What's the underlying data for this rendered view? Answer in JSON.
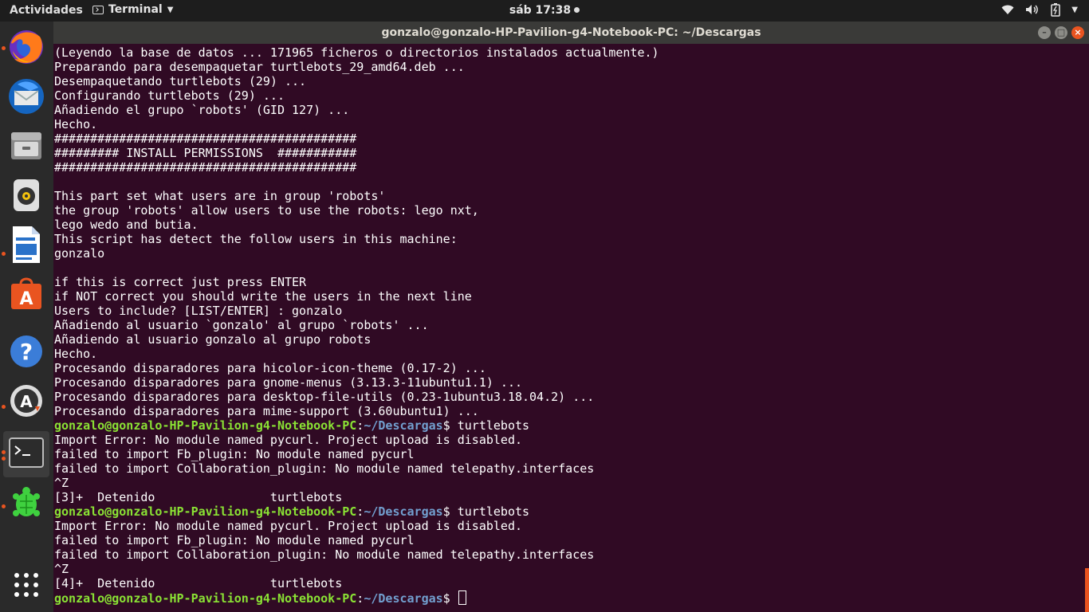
{
  "topbar": {
    "activities": "Actividades",
    "app_name": "Terminal",
    "clock": "sáb 17:38",
    "tray_icons": [
      "wifi-icon",
      "volume-icon",
      "battery-icon",
      "power-menu-icon"
    ]
  },
  "dock": {
    "items": [
      {
        "name": "firefox",
        "running": true
      },
      {
        "name": "thunderbird",
        "running": false
      },
      {
        "name": "files",
        "running": false
      },
      {
        "name": "rhythmbox",
        "running": false
      },
      {
        "name": "libreoffice-writer",
        "running": true
      },
      {
        "name": "ubuntu-software",
        "running": false
      },
      {
        "name": "help",
        "running": false
      },
      {
        "name": "software-updater",
        "running": true
      },
      {
        "name": "terminal",
        "running": true
      },
      {
        "name": "turtlebots",
        "running": true
      }
    ],
    "show_apps": "show-applications-icon"
  },
  "window": {
    "title": "gonzalo@gonzalo-HP-Pavilion-g4-Notebook-PC: ~/Descargas",
    "controls": [
      "minimize",
      "maximize",
      "close"
    ]
  },
  "prompt": {
    "user": "gonzalo@gonzalo-HP-Pavilion-g4-Notebook-PC",
    "sep": ":",
    "path": "~/Descargas",
    "symbol": "$ "
  },
  "terminal_lines": [
    "(Leyendo la base de datos ... 171965 ficheros o directorios instalados actualmente.)",
    "Preparando para desempaquetar turtlebots_29_amd64.deb ...",
    "Desempaquetando turtlebots (29) ...",
    "Configurando turtlebots (29) ...",
    "Añadiendo el grupo `robots' (GID 127) ...",
    "Hecho.",
    "##########################################",
    "######### INSTALL PERMISSIONS  ###########",
    "##########################################",
    "",
    "This part set what users are in group 'robots'",
    "the group 'robots' allow users to use the robots: lego nxt,",
    "lego wedo and butia.",
    "This script has detect the follow users in this machine:",
    "gonzalo",
    "",
    "if this is correct just press ENTER",
    "if NOT correct you should write the users in the next line",
    "Users to include? [LIST/ENTER] : gonzalo",
    "Añadiendo al usuario `gonzalo' al grupo `robots' ...",
    "Añadiendo al usuario gonzalo al grupo robots",
    "Hecho.",
    "Procesando disparadores para hicolor-icon-theme (0.17-2) ...",
    "Procesando disparadores para gnome-menus (3.13.3-11ubuntu1.1) ...",
    "Procesando disparadores para desktop-file-utils (0.23-1ubuntu3.18.04.2) ...",
    "Procesando disparadores para mime-support (3.60ubuntu1) ...",
    {
      "prompt": true,
      "cmd": "turtlebots"
    },
    "Import Error: No module named pycurl. Project upload is disabled.",
    "failed to import Fb_plugin: No module named pycurl",
    "failed to import Collaboration_plugin: No module named telepathy.interfaces",
    "^Z",
    "[3]+  Detenido                turtlebots",
    {
      "prompt": true,
      "cmd": "turtlebots"
    },
    "Import Error: No module named pycurl. Project upload is disabled.",
    "failed to import Fb_plugin: No module named pycurl",
    "failed to import Collaboration_plugin: No module named telepathy.interfaces",
    "^Z",
    "[4]+  Detenido                turtlebots",
    {
      "prompt": true,
      "cmd": "",
      "cursor": true
    }
  ],
  "colors": {
    "terminal_bg": "#300a24",
    "prompt_user": "#8ae234",
    "prompt_path": "#729fcf",
    "accent": "#e95420"
  }
}
